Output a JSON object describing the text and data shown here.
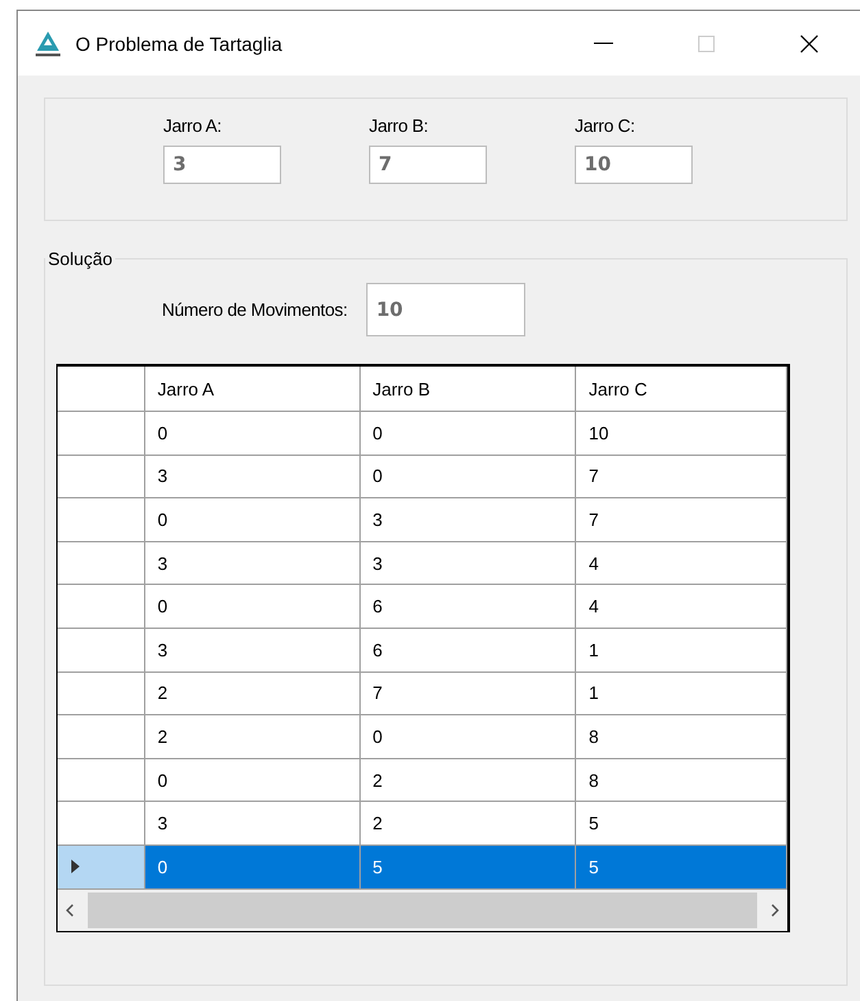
{
  "window": {
    "title": "O Problema de Tartaglia"
  },
  "jars": [
    {
      "label": "Jarro A:",
      "value": "3"
    },
    {
      "label": "Jarro B:",
      "value": "7"
    },
    {
      "label": "Jarro C:",
      "value": "10"
    }
  ],
  "solution": {
    "title": "Solução",
    "moves_label": "Número de Movimentos:",
    "moves_value": "10"
  },
  "table": {
    "columns": [
      "Jarro A",
      "Jarro B",
      "Jarro C"
    ],
    "rows": [
      {
        "cells": [
          "0",
          "0",
          "10"
        ],
        "selected": false
      },
      {
        "cells": [
          "3",
          "0",
          "7"
        ],
        "selected": false
      },
      {
        "cells": [
          "0",
          "3",
          "7"
        ],
        "selected": false
      },
      {
        "cells": [
          "3",
          "3",
          "4"
        ],
        "selected": false
      },
      {
        "cells": [
          "0",
          "6",
          "4"
        ],
        "selected": false
      },
      {
        "cells": [
          "3",
          "6",
          "1"
        ],
        "selected": false
      },
      {
        "cells": [
          "2",
          "7",
          "1"
        ],
        "selected": false
      },
      {
        "cells": [
          "2",
          "0",
          "8"
        ],
        "selected": false
      },
      {
        "cells": [
          "0",
          "2",
          "8"
        ],
        "selected": false
      },
      {
        "cells": [
          "3",
          "2",
          "5"
        ],
        "selected": false
      },
      {
        "cells": [
          "0",
          "5",
          "5"
        ],
        "selected": true
      }
    ]
  }
}
